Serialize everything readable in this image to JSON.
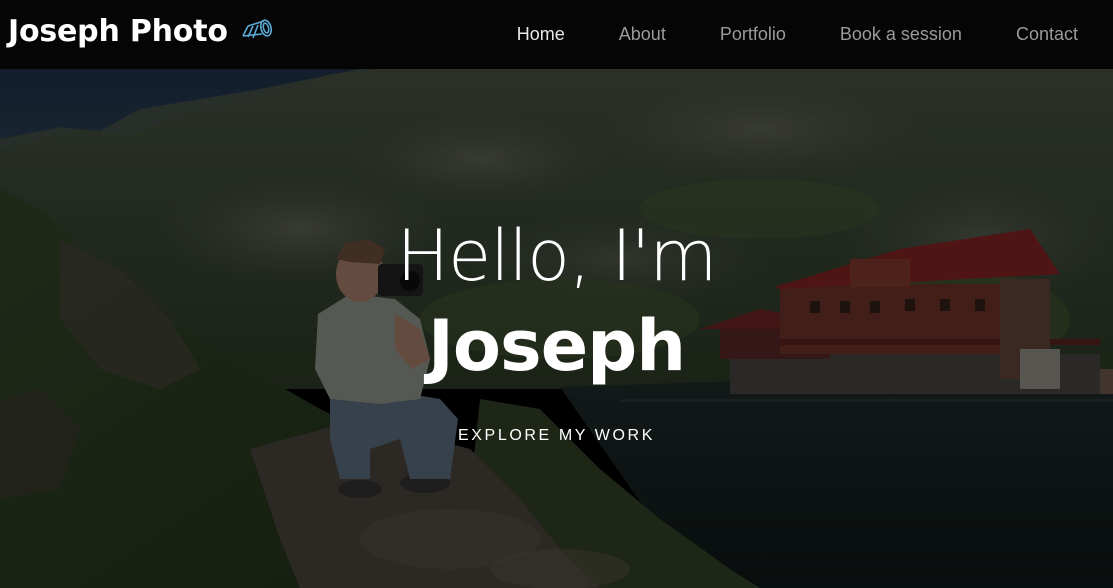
{
  "navbar": {
    "brand": "Joseph Photo",
    "brand_icon": "camera-lens-icon",
    "links": [
      {
        "label": "Home",
        "active": true
      },
      {
        "label": "About",
        "active": false
      },
      {
        "label": "Portfolio",
        "active": false
      },
      {
        "label": "Book a session",
        "active": false
      },
      {
        "label": "Contact",
        "active": false
      }
    ]
  },
  "hero": {
    "greeting": "Hello, I'm",
    "name": "Joseph",
    "cta": "EXPLORE MY WORK"
  },
  "colors": {
    "navbar_bg": "#050505",
    "nav_active": "#e8e8e8",
    "nav_inactive": "#9a9a9a",
    "brand_icon": "#5aa9d6",
    "hero_text": "#ffffff"
  }
}
